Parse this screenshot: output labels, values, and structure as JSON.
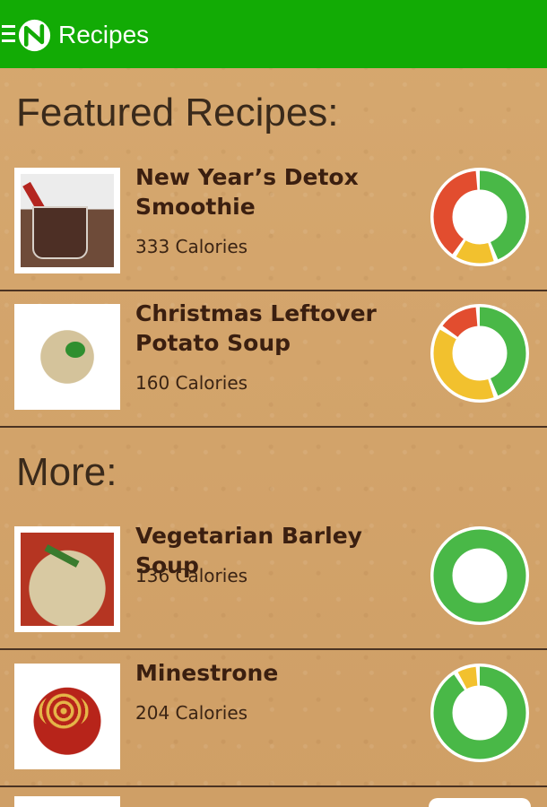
{
  "app": {
    "title": "Recipes"
  },
  "sections": {
    "featured": "Featured Recipes:",
    "more": "More:"
  },
  "recipes": [
    {
      "name": "New Year’s Detox Smoothie",
      "calories": "333 Calories",
      "macros": {
        "green": 0.45,
        "yellow": 0.15,
        "red": 0.4
      }
    },
    {
      "name": "Christmas Leftover Potato Soup",
      "calories": "160 Calories",
      "macros": {
        "green": 0.45,
        "yellow": 0.4,
        "red": 0.15
      }
    },
    {
      "name": "Vegetarian Barley Soup",
      "calories": "136 Calories",
      "macros": {
        "green": 1.0,
        "yellow": 0,
        "red": 0
      }
    },
    {
      "name": "Minestrone",
      "calories": "204 Calories",
      "macros": {
        "green": 0.92,
        "yellow": 0.08,
        "red": 0
      }
    }
  ],
  "colors": {
    "appbar": "#12ab05",
    "green": "#49b847",
    "yellow": "#f2c12e",
    "red": "#e24d2f"
  },
  "icons": {
    "menu": "menu-icon",
    "logo": "app-logo-icon"
  }
}
